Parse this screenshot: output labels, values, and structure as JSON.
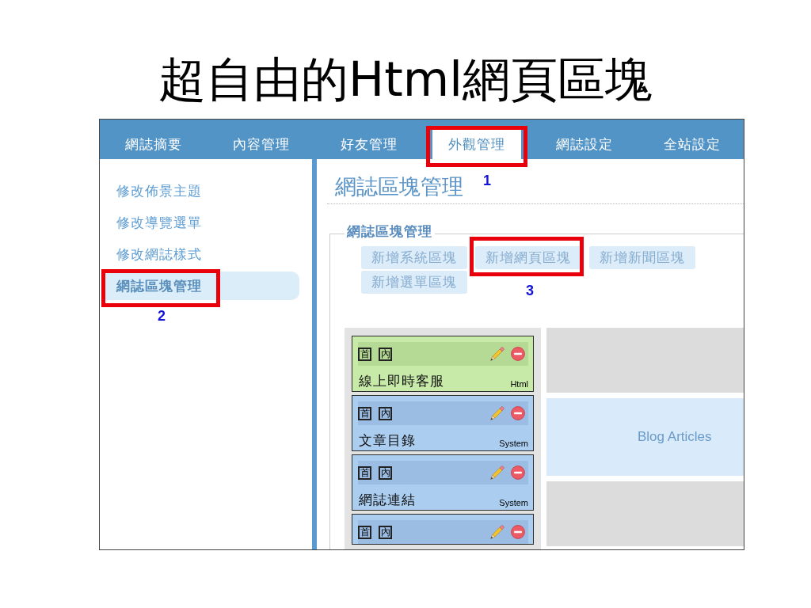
{
  "slide": {
    "title": "超自由的Html網頁區塊"
  },
  "screenshot": {
    "nav": {
      "tabs": [
        {
          "label": "網誌摘要",
          "selected": false,
          "highlighted": false
        },
        {
          "label": "內容管理",
          "selected": false,
          "highlighted": false
        },
        {
          "label": "好友管理",
          "selected": false,
          "highlighted": false
        },
        {
          "label": "外觀管理",
          "selected": true,
          "highlighted": true,
          "callout": "1"
        },
        {
          "label": "網誌設定",
          "selected": false,
          "highlighted": false
        },
        {
          "label": "全站設定",
          "selected": false,
          "highlighted": false
        }
      ]
    },
    "sidebar": {
      "items": [
        {
          "label": "修改佈景主題",
          "selected": false,
          "highlighted": false
        },
        {
          "label": "修改導覽選單",
          "selected": false,
          "highlighted": false
        },
        {
          "label": "修改網誌樣式",
          "selected": false,
          "highlighted": false
        },
        {
          "label": "網誌區塊管理",
          "selected": true,
          "highlighted": true,
          "callout": "2"
        }
      ]
    },
    "main": {
      "heading": "網誌區塊管理",
      "group": {
        "legend": "網誌區塊管理",
        "buttons": [
          {
            "label": "新增系統區塊",
            "highlighted": false
          },
          {
            "label": "新增網頁區塊",
            "highlighted": true,
            "callout": "3"
          },
          {
            "label": "新增新聞區塊",
            "highlighted": false
          },
          {
            "label": "新增選單區塊",
            "highlighted": false
          }
        ]
      },
      "blocks": [
        {
          "kind": "html",
          "badges": [
            "首",
            "內"
          ],
          "name": "線上即時客服",
          "type": "Html"
        },
        {
          "kind": "system",
          "badges": [
            "首",
            "內"
          ],
          "name": "文章目錄",
          "type": "System"
        },
        {
          "kind": "system",
          "badges": [
            "首",
            "內"
          ],
          "name": "網誌連結",
          "type": "System"
        },
        {
          "kind": "system",
          "badges": [
            "首",
            "內"
          ]
        }
      ],
      "zones": [
        {
          "kind": "empty"
        },
        {
          "kind": "block",
          "label": "Blog Articles"
        },
        {
          "kind": "empty"
        }
      ]
    }
  }
}
